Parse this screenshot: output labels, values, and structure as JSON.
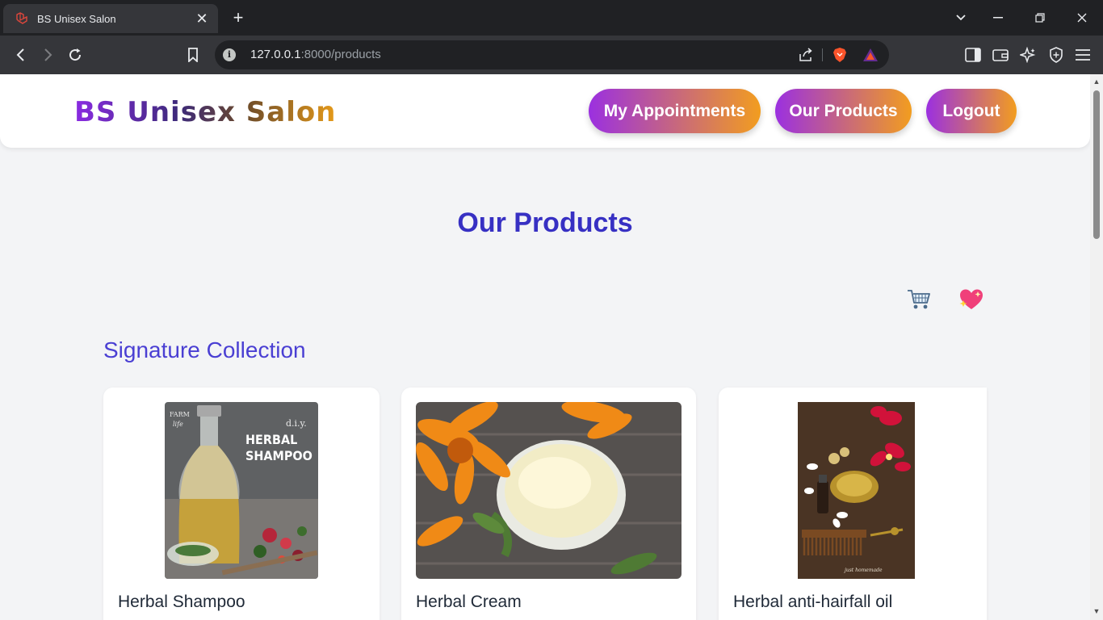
{
  "browser": {
    "tab_title": "BS Unisex Salon",
    "url_host": "127.0.0.1",
    "url_rest": ":8000/products"
  },
  "header": {
    "brand": "BS Unisex Salon",
    "nav": [
      {
        "label": "My Appointments"
      },
      {
        "label": "Our Products"
      },
      {
        "label": "Logout"
      }
    ]
  },
  "main": {
    "title": "Our Products",
    "cart_icon": "shopping-cart-icon",
    "wishlist_icon": "sparkling-heart-icon",
    "section_title": "Signature Collection",
    "products": [
      {
        "name": "Herbal Shampoo",
        "image_text_1": "FARM",
        "image_text_2": "life",
        "image_text_3": "d.i.y.",
        "image_text_4": "HERBAL",
        "image_text_5": "SHAMPOO"
      },
      {
        "name": "Herbal Cream"
      },
      {
        "name": "Herbal anti-hairfall oil",
        "image_text_1": "just homemade"
      }
    ]
  },
  "colors": {
    "accent_start": "#9b30e0",
    "accent_end": "#f29d1f",
    "title": "#3730c3"
  }
}
